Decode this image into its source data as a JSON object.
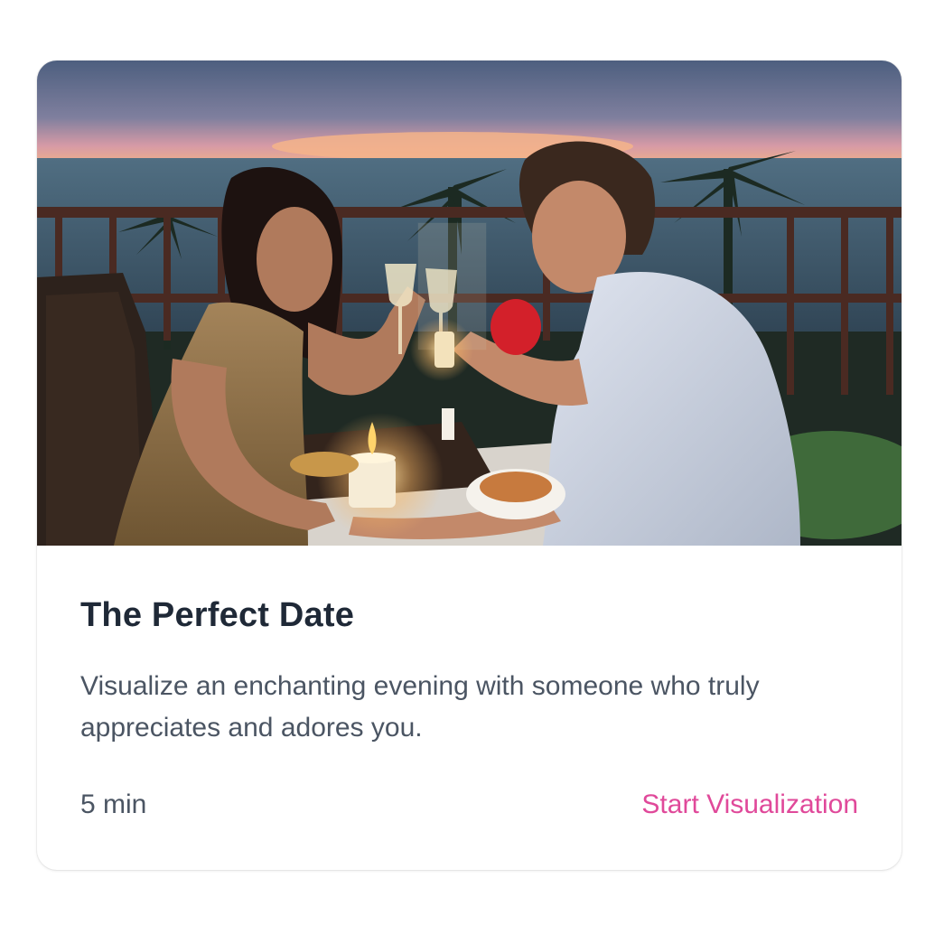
{
  "card": {
    "image": {
      "icon": "romantic-dinner-photo"
    },
    "title": "The Perfect Date",
    "description": "Visualize an enchanting evening with someone who truly appreciates and adores you.",
    "duration": "5 min",
    "cta_label": "Start Visualization"
  },
  "colors": {
    "accent": "#e0499a",
    "title": "#1f2937",
    "body_text": "#4b5563"
  }
}
